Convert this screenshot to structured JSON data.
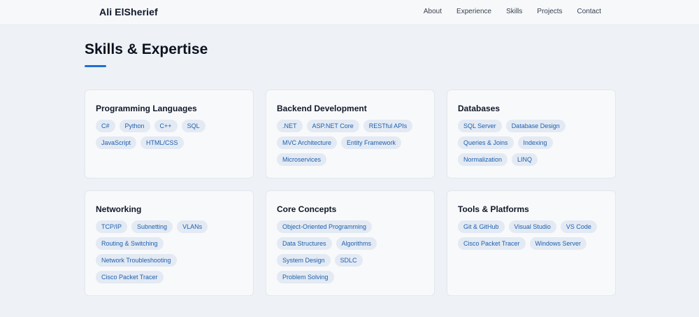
{
  "header": {
    "brand": "Ali ElSherief",
    "nav": [
      "About",
      "Experience",
      "Skills",
      "Projects",
      "Contact"
    ]
  },
  "skills": {
    "title": "Skills & Expertise",
    "cards": [
      {
        "title": "Programming Languages",
        "tags": [
          "C#",
          "Python",
          "C++",
          "SQL",
          "JavaScript",
          "HTML/CSS"
        ]
      },
      {
        "title": "Backend Development",
        "tags": [
          ".NET",
          "ASP.NET Core",
          "RESTful APIs",
          "MVC Architecture",
          "Entity Framework",
          "Microservices"
        ]
      },
      {
        "title": "Databases",
        "tags": [
          "SQL Server",
          "Database Design",
          "Queries & Joins",
          "Indexing",
          "Normalization",
          "LINQ"
        ]
      },
      {
        "title": "Networking",
        "tags": [
          "TCP/IP",
          "Subnetting",
          "VLANs",
          "Routing & Switching",
          "Network Troubleshooting",
          "Cisco Packet Tracer"
        ]
      },
      {
        "title": "Core Concepts",
        "tags": [
          "Object-Oriented Programming",
          "Data Structures",
          "Algorithms",
          "System Design",
          "SDLC",
          "Problem Solving"
        ]
      },
      {
        "title": "Tools & Platforms",
        "tags": [
          "Git & GitHub",
          "Visual Studio",
          "VS Code",
          "Cisco Packet Tracer",
          "Windows Server"
        ]
      }
    ]
  }
}
